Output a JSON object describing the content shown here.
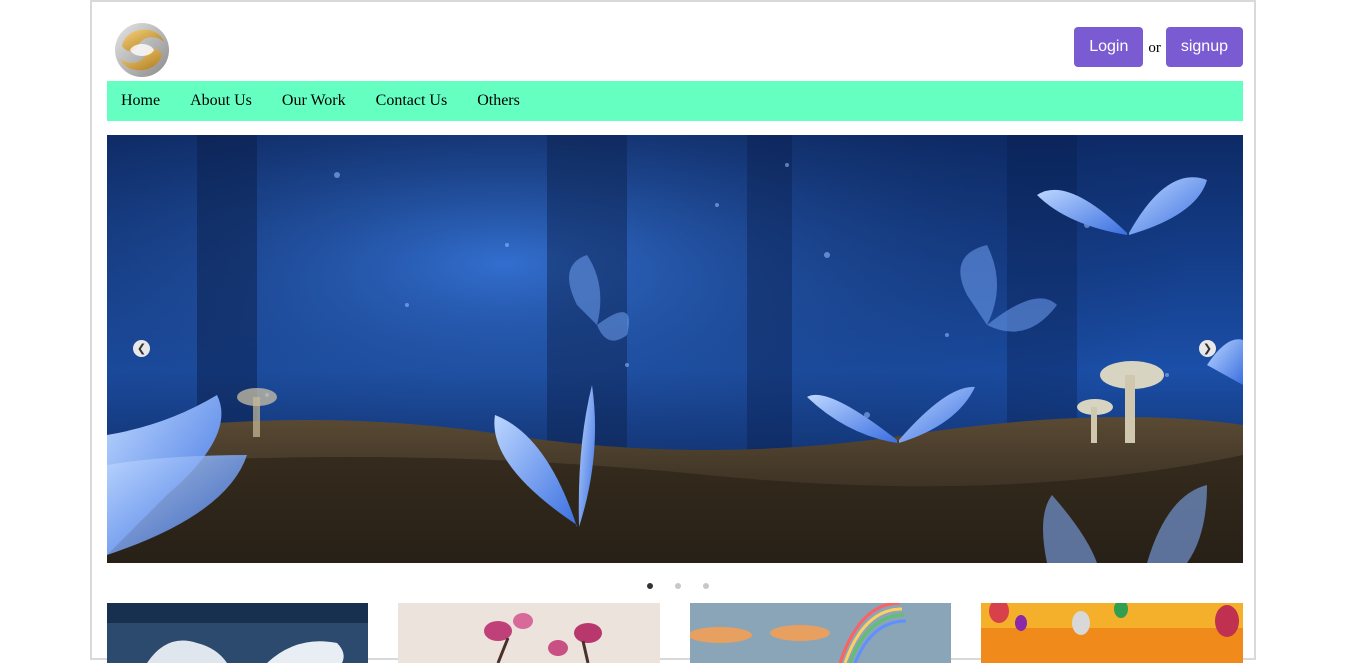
{
  "header": {
    "logo": "site-logo",
    "login_label": "Login",
    "or_text": "or",
    "signup_label": "signup"
  },
  "nav": {
    "items": [
      {
        "label": "Home"
      },
      {
        "label": "About Us"
      },
      {
        "label": "Our Work"
      },
      {
        "label": "Contact Us"
      },
      {
        "label": "Others"
      }
    ]
  },
  "slider": {
    "image": "blue butterflies in a forest",
    "prev_icon": "chevron-left-icon",
    "next_icon": "chevron-right-icon",
    "slide_count": 3,
    "active_slide": 1
  },
  "gallery": {
    "thumbnails": [
      {
        "name": "cruise-ship"
      },
      {
        "name": "pink-flowers"
      },
      {
        "name": "rainbow-sky"
      },
      {
        "name": "hot-air-balloons"
      }
    ]
  },
  "colors": {
    "nav_bg": "#66ffc2",
    "button_bg": "#7a5bd1"
  }
}
